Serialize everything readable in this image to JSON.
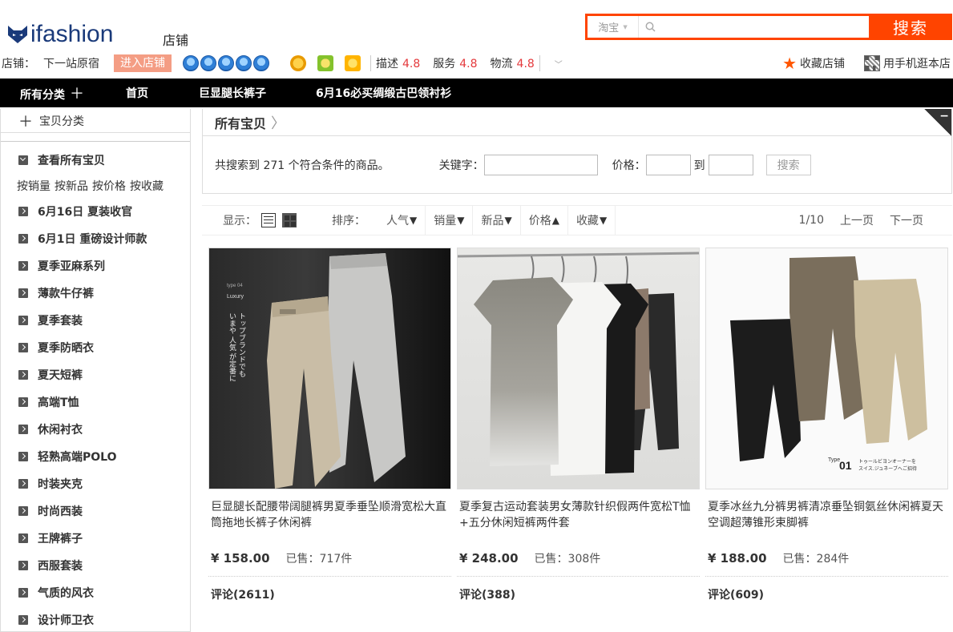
{
  "header": {
    "logo_text": "ifashion",
    "store_label": "店铺",
    "search": {
      "scope": "淘宝",
      "placeholder": "",
      "button": "搜索"
    }
  },
  "shop_bar": {
    "shop_label": "店铺：",
    "shop_name": "下一站原宿",
    "enter_button": "进入店铺",
    "ratings": [
      {
        "label": "描述",
        "value": "4.8"
      },
      {
        "label": "服务",
        "value": "4.8"
      },
      {
        "label": "物流",
        "value": "4.8"
      }
    ],
    "favorite": "收藏店铺",
    "mobile": "用手机逛本店"
  },
  "nav": {
    "items": [
      "所有分类",
      "首页",
      "巨显腿长裤子",
      "6月16必买绸缎古巴领衬衫"
    ]
  },
  "sidebar": {
    "header": "宝贝分类",
    "all": "查看所有宝贝",
    "sorts": [
      "按销量",
      "按新品",
      "按价格",
      "按收藏"
    ],
    "categories": [
      "6月16日 夏装收官",
      "6月1日 重磅设计师款",
      "夏季亚麻系列",
      "薄款牛仔裤",
      "夏季套装",
      "夏季防晒衣",
      "夏天短裤",
      "高端T恤",
      "休闲衬衣",
      "轻熟高端POLO",
      "时装夹克",
      "时尚西装",
      "王牌裤子",
      "西服套装",
      "气质的风衣",
      "设计师卫衣"
    ]
  },
  "main": {
    "title": "所有宝贝",
    "result_prefix": "共搜索到 ",
    "result_count": "271",
    "result_suffix": " 个符合条件的商品。",
    "keyword_label": "关键字：",
    "price_label": "价格：",
    "to_label": "到",
    "search_button": "搜索",
    "display_label": "显示：",
    "sort_label": "排序：",
    "sort_items": [
      {
        "label": "人气",
        "dir": "down"
      },
      {
        "label": "销量",
        "dir": "down"
      },
      {
        "label": "新品",
        "dir": "down"
      },
      {
        "label": "价格",
        "dir": "up"
      },
      {
        "label": "收藏",
        "dir": "down"
      }
    ],
    "page": "1/10",
    "prev": "上一页",
    "next": "下一页"
  },
  "products": [
    {
      "title": "巨显腿长配腰带阔腿裤男夏季垂坠顺滑宽松大直筒拖地长裤子休闲裤",
      "price": "¥ 158.00",
      "sold_label": "已售：",
      "sold": "717件",
      "reviews": "评论(2611)",
      "image_text": [
        "type 04",
        "Luxury",
        "トップブランドでも",
        "いまや 人気 が定番に"
      ]
    },
    {
      "title": "夏季复古运动套装男女薄款针织假两件宽松T恤+五分休闲短裤两件套",
      "price": "¥ 248.00",
      "sold_label": "已售：",
      "sold": "308件",
      "reviews": "评论(388)",
      "image_text": []
    },
    {
      "title": "夏季冰丝九分裤男裤清凉垂坠铜氨丝休闲裤夏天空调超薄锥形束脚裤",
      "price": "¥ 188.00",
      "sold_label": "已售：",
      "sold": "284件",
      "reviews": "评论(609)",
      "image_text": [
        "Type",
        "01",
        "トゥールビヨンオーナーを",
        "スイス.ジュネーブへご招待"
      ]
    }
  ],
  "colors": {
    "accent": "#ff4400",
    "nav_bg": "#000000",
    "rating": "#e4393c",
    "enter_button": "#f49d84"
  }
}
